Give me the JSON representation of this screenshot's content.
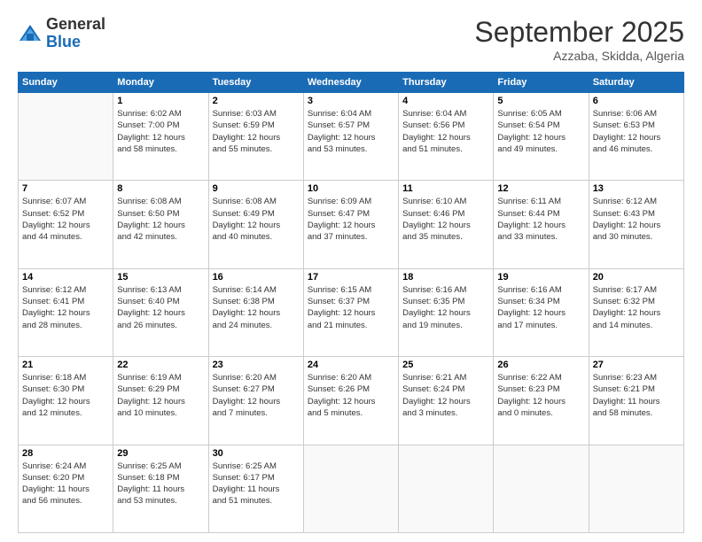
{
  "header": {
    "logo_general": "General",
    "logo_blue": "Blue",
    "month": "September 2025",
    "location": "Azzaba, Skidda, Algeria"
  },
  "days_of_week": [
    "Sunday",
    "Monday",
    "Tuesday",
    "Wednesday",
    "Thursday",
    "Friday",
    "Saturday"
  ],
  "weeks": [
    [
      {
        "day": "",
        "info": ""
      },
      {
        "day": "1",
        "info": "Sunrise: 6:02 AM\nSunset: 7:00 PM\nDaylight: 12 hours\nand 58 minutes."
      },
      {
        "day": "2",
        "info": "Sunrise: 6:03 AM\nSunset: 6:59 PM\nDaylight: 12 hours\nand 55 minutes."
      },
      {
        "day": "3",
        "info": "Sunrise: 6:04 AM\nSunset: 6:57 PM\nDaylight: 12 hours\nand 53 minutes."
      },
      {
        "day": "4",
        "info": "Sunrise: 6:04 AM\nSunset: 6:56 PM\nDaylight: 12 hours\nand 51 minutes."
      },
      {
        "day": "5",
        "info": "Sunrise: 6:05 AM\nSunset: 6:54 PM\nDaylight: 12 hours\nand 49 minutes."
      },
      {
        "day": "6",
        "info": "Sunrise: 6:06 AM\nSunset: 6:53 PM\nDaylight: 12 hours\nand 46 minutes."
      }
    ],
    [
      {
        "day": "7",
        "info": "Sunrise: 6:07 AM\nSunset: 6:52 PM\nDaylight: 12 hours\nand 44 minutes."
      },
      {
        "day": "8",
        "info": "Sunrise: 6:08 AM\nSunset: 6:50 PM\nDaylight: 12 hours\nand 42 minutes."
      },
      {
        "day": "9",
        "info": "Sunrise: 6:08 AM\nSunset: 6:49 PM\nDaylight: 12 hours\nand 40 minutes."
      },
      {
        "day": "10",
        "info": "Sunrise: 6:09 AM\nSunset: 6:47 PM\nDaylight: 12 hours\nand 37 minutes."
      },
      {
        "day": "11",
        "info": "Sunrise: 6:10 AM\nSunset: 6:46 PM\nDaylight: 12 hours\nand 35 minutes."
      },
      {
        "day": "12",
        "info": "Sunrise: 6:11 AM\nSunset: 6:44 PM\nDaylight: 12 hours\nand 33 minutes."
      },
      {
        "day": "13",
        "info": "Sunrise: 6:12 AM\nSunset: 6:43 PM\nDaylight: 12 hours\nand 30 minutes."
      }
    ],
    [
      {
        "day": "14",
        "info": "Sunrise: 6:12 AM\nSunset: 6:41 PM\nDaylight: 12 hours\nand 28 minutes."
      },
      {
        "day": "15",
        "info": "Sunrise: 6:13 AM\nSunset: 6:40 PM\nDaylight: 12 hours\nand 26 minutes."
      },
      {
        "day": "16",
        "info": "Sunrise: 6:14 AM\nSunset: 6:38 PM\nDaylight: 12 hours\nand 24 minutes."
      },
      {
        "day": "17",
        "info": "Sunrise: 6:15 AM\nSunset: 6:37 PM\nDaylight: 12 hours\nand 21 minutes."
      },
      {
        "day": "18",
        "info": "Sunrise: 6:16 AM\nSunset: 6:35 PM\nDaylight: 12 hours\nand 19 minutes."
      },
      {
        "day": "19",
        "info": "Sunrise: 6:16 AM\nSunset: 6:34 PM\nDaylight: 12 hours\nand 17 minutes."
      },
      {
        "day": "20",
        "info": "Sunrise: 6:17 AM\nSunset: 6:32 PM\nDaylight: 12 hours\nand 14 minutes."
      }
    ],
    [
      {
        "day": "21",
        "info": "Sunrise: 6:18 AM\nSunset: 6:30 PM\nDaylight: 12 hours\nand 12 minutes."
      },
      {
        "day": "22",
        "info": "Sunrise: 6:19 AM\nSunset: 6:29 PM\nDaylight: 12 hours\nand 10 minutes."
      },
      {
        "day": "23",
        "info": "Sunrise: 6:20 AM\nSunset: 6:27 PM\nDaylight: 12 hours\nand 7 minutes."
      },
      {
        "day": "24",
        "info": "Sunrise: 6:20 AM\nSunset: 6:26 PM\nDaylight: 12 hours\nand 5 minutes."
      },
      {
        "day": "25",
        "info": "Sunrise: 6:21 AM\nSunset: 6:24 PM\nDaylight: 12 hours\nand 3 minutes."
      },
      {
        "day": "26",
        "info": "Sunrise: 6:22 AM\nSunset: 6:23 PM\nDaylight: 12 hours\nand 0 minutes."
      },
      {
        "day": "27",
        "info": "Sunrise: 6:23 AM\nSunset: 6:21 PM\nDaylight: 11 hours\nand 58 minutes."
      }
    ],
    [
      {
        "day": "28",
        "info": "Sunrise: 6:24 AM\nSunset: 6:20 PM\nDaylight: 11 hours\nand 56 minutes."
      },
      {
        "day": "29",
        "info": "Sunrise: 6:25 AM\nSunset: 6:18 PM\nDaylight: 11 hours\nand 53 minutes."
      },
      {
        "day": "30",
        "info": "Sunrise: 6:25 AM\nSunset: 6:17 PM\nDaylight: 11 hours\nand 51 minutes."
      },
      {
        "day": "",
        "info": ""
      },
      {
        "day": "",
        "info": ""
      },
      {
        "day": "",
        "info": ""
      },
      {
        "day": "",
        "info": ""
      }
    ]
  ]
}
